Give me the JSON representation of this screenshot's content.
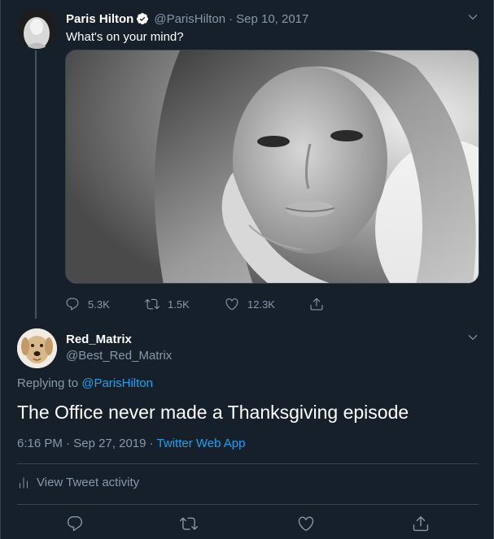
{
  "parent_tweet": {
    "author_name": "Paris Hilton",
    "handle": "@ParisHilton",
    "separator": "·",
    "date": "Sep 10, 2017",
    "text": "What's on your mind?",
    "stats": {
      "replies": "5.3K",
      "retweets": "1.5K",
      "likes": "12.3K"
    }
  },
  "reply_tweet": {
    "author_name": "Red_Matrix",
    "handle": "@Best_Red_Matrix",
    "replying_prefix": "Replying to",
    "replying_to": "@ParisHilton",
    "text": "The Office never made a Thanksgiving episode",
    "time": "6:16 PM",
    "separator": "·",
    "date": "Sep 27, 2019",
    "separator2": "·",
    "source": "Twitter Web App",
    "activity_label": "View Tweet activity"
  },
  "colors": {
    "background": "#15202b",
    "muted": "#8899a6",
    "accent": "#1da1f2",
    "border": "#38444d"
  },
  "icons": {
    "verified": "verified-badge-icon",
    "chevron": "chevron-down-icon",
    "reply": "reply-icon",
    "retweet": "retweet-icon",
    "like": "heart-icon",
    "share": "share-icon",
    "activity": "bar-chart-icon"
  }
}
